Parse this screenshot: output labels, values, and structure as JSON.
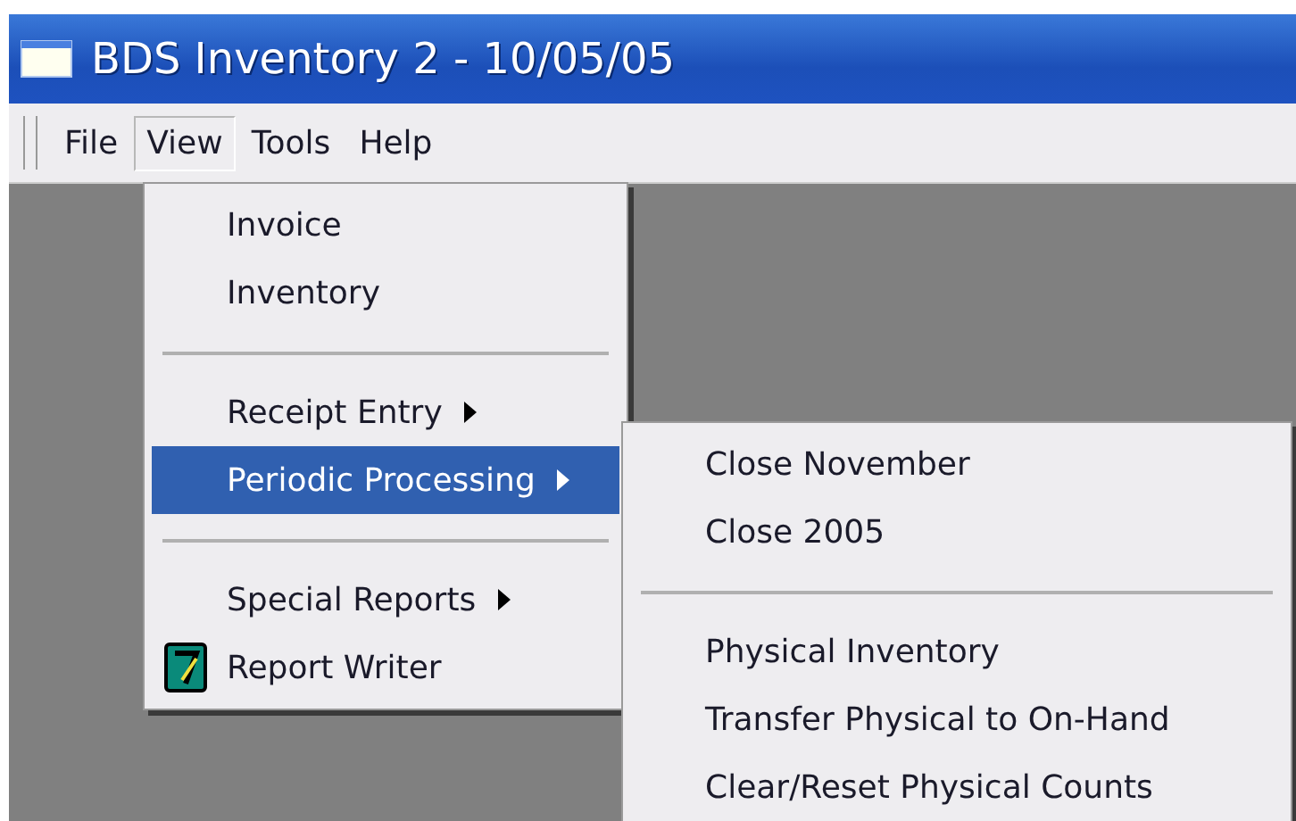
{
  "window": {
    "title": "BDS Inventory 2 - 10/05/05"
  },
  "menu_bar": [
    {
      "label": "File",
      "selected": false
    },
    {
      "label": "View",
      "selected": true
    },
    {
      "label": "Tools",
      "selected": false
    },
    {
      "label": "Help",
      "selected": false
    }
  ],
  "view_menu": {
    "items": [
      {
        "kind": "item",
        "label": "Invoice",
        "selected": false,
        "submenu": false,
        "icon": false
      },
      {
        "kind": "item",
        "label": "Inventory",
        "selected": false,
        "submenu": false,
        "icon": false
      },
      {
        "kind": "separator"
      },
      {
        "kind": "item",
        "label": "Receipt Entry",
        "selected": false,
        "submenu": true,
        "icon": false
      },
      {
        "kind": "item",
        "label": "Periodic Processing",
        "selected": true,
        "submenu": true,
        "icon": false
      },
      {
        "kind": "separator"
      },
      {
        "kind": "item",
        "label": "Special Reports",
        "selected": false,
        "submenu": true,
        "icon": false
      },
      {
        "kind": "item",
        "label": "Report Writer",
        "selected": false,
        "submenu": false,
        "icon": true
      }
    ]
  },
  "periodic_processing_menu": {
    "items": [
      {
        "kind": "item",
        "label": "Close November",
        "selected": false,
        "submenu": false,
        "icon": false
      },
      {
        "kind": "item",
        "label": "Close 2005",
        "selected": false,
        "submenu": false,
        "icon": false
      },
      {
        "kind": "separator"
      },
      {
        "kind": "item",
        "label": "Physical Inventory",
        "selected": false,
        "submenu": false,
        "icon": false
      },
      {
        "kind": "item",
        "label": "Transfer Physical to On-Hand",
        "selected": false,
        "submenu": false,
        "icon": false
      },
      {
        "kind": "item",
        "label": "Clear/Reset Physical Counts",
        "selected": false,
        "submenu": false,
        "icon": false
      }
    ]
  }
}
